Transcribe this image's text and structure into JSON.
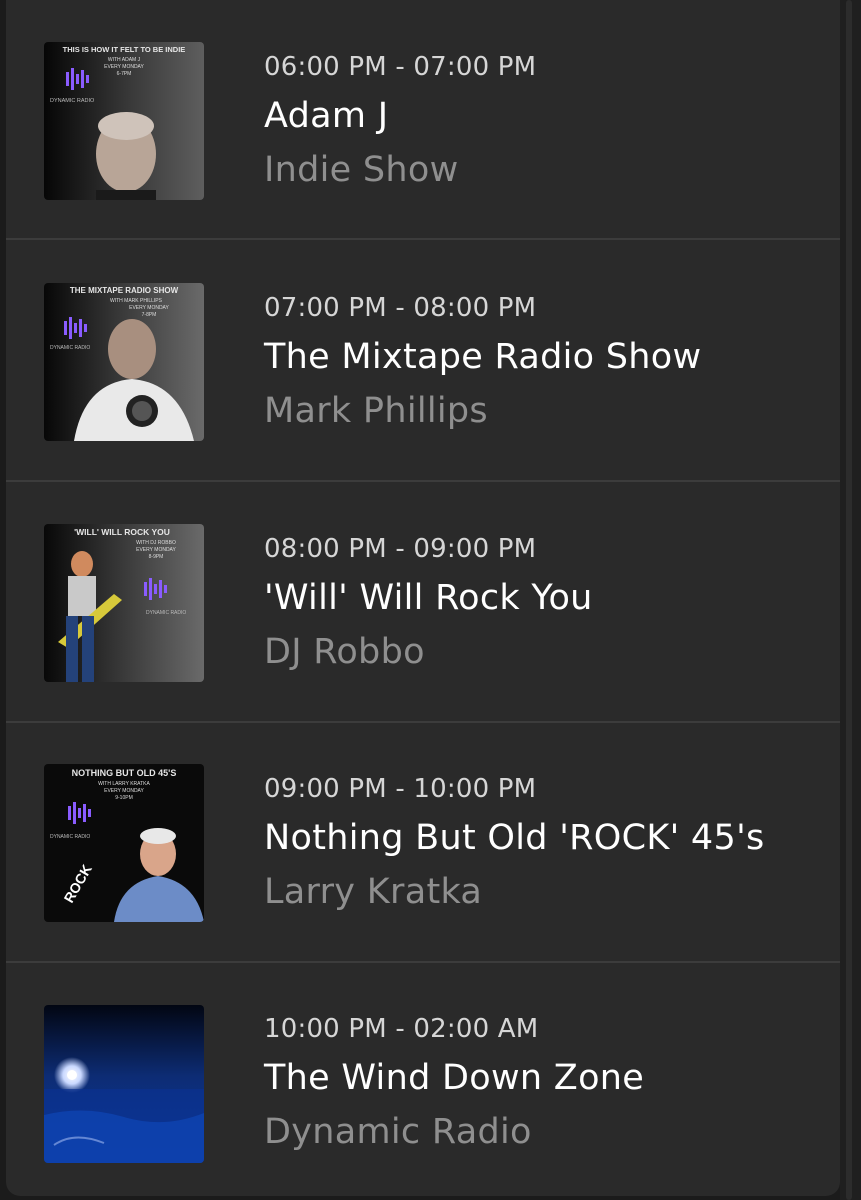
{
  "schedule": {
    "items": [
      {
        "time": "06:00 PM - 07:00 PM",
        "title": "Adam J",
        "subtitle": "Indie Show",
        "art": {
          "line1": "THIS IS HOW IT FELT TO BE INDIE",
          "line2": "WITH ADAM J",
          "line3": "EVERY MONDAY",
          "line4": "6-7PM",
          "brand": "DYNAMIC RADIO"
        }
      },
      {
        "time": "07:00 PM - 08:00 PM",
        "title": "The Mixtape Radio Show",
        "subtitle": "Mark Phillips",
        "art": {
          "line1": "THE MIXTAPE RADIO SHOW",
          "line2": "WITH MARK PHILLIPS",
          "line3": "EVERY MONDAY",
          "line4": "7-8PM",
          "brand": "DYNAMIC RADIO"
        }
      },
      {
        "time": "08:00 PM - 09:00 PM",
        "title": "'Will' Will Rock You",
        "subtitle": "DJ Robbo",
        "art": {
          "line1": "'WILL' WILL ROCK YOU",
          "line2": "WITH DJ ROBBO",
          "line3": "EVERY MONDAY",
          "line4": "8-9PM",
          "brand": "DYNAMIC RADIO"
        }
      },
      {
        "time": "09:00 PM - 10:00 PM",
        "title": "Nothing But Old 'ROCK' 45's",
        "subtitle": "Larry Kratka",
        "art": {
          "line1": "NOTHING BUT OLD 45'S",
          "line2": "WITH LARRY KRATKA",
          "line3": "EVERY MONDAY",
          "line4": "9-10PM",
          "brand": "DYNAMIC RADIO",
          "badge": "ROCK"
        }
      },
      {
        "time": "10:00 PM - 02:00 AM",
        "title": "The Wind Down Zone",
        "subtitle": "Dynamic Radio",
        "art": {}
      }
    ]
  },
  "colors": {
    "panel": "#2a2a2a",
    "divider": "#3c3c3c",
    "title": "#ffffff",
    "subtitle": "#8f8f8f",
    "logo": "#8a5cff"
  }
}
